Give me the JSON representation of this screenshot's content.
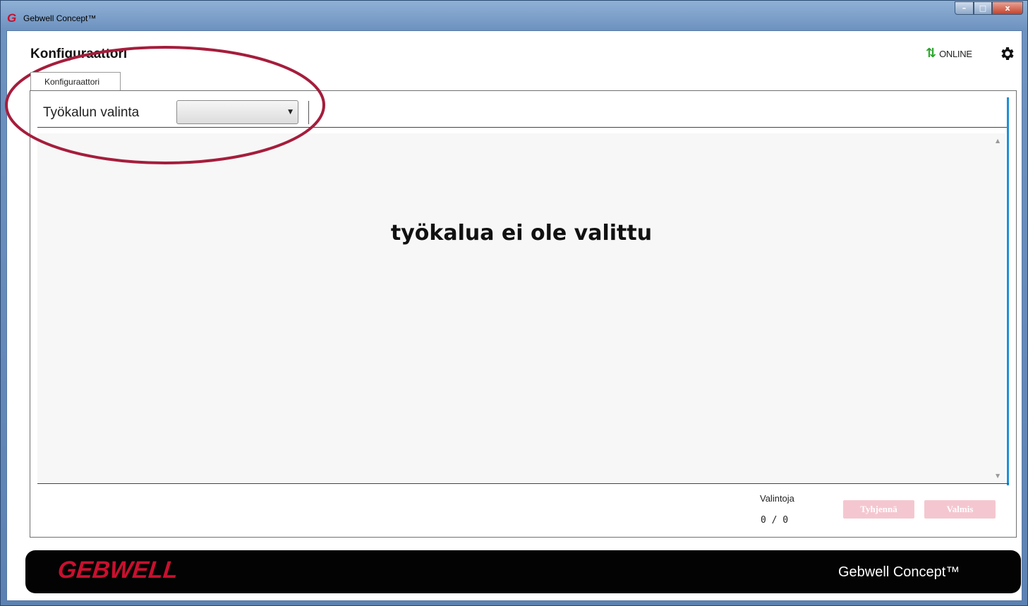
{
  "window": {
    "title": "Gebwell Concept™",
    "app_icon_glyph": "G",
    "controls": {
      "minimize": "–",
      "maximize": "□",
      "close": "x"
    }
  },
  "header": {
    "page_title": "Konfiguraattori",
    "status_label": "ONLINE",
    "status_icon": "up-down-arrows-icon",
    "status_color": "#2aa52a",
    "settings_icon": "gear-icon"
  },
  "tabs": [
    {
      "label": "Konfiguraattori",
      "active": true
    }
  ],
  "toolbar": {
    "tool_select_label": "Työkalun valinta",
    "tool_select_value": ""
  },
  "content": {
    "empty_message": "työkalua ei ole valittu"
  },
  "selection": {
    "label": "Valintoja",
    "count": "0 / 0"
  },
  "actions": {
    "clear_label": "Tyhjennä",
    "done_label": "Valmis",
    "disabled": true,
    "button_color": "#f4c7d0"
  },
  "footer": {
    "brand": "GEBWELL",
    "product": "Gebwell Concept™",
    "brand_color": "#c8102e"
  },
  "annotation_color": "#a51d3c"
}
